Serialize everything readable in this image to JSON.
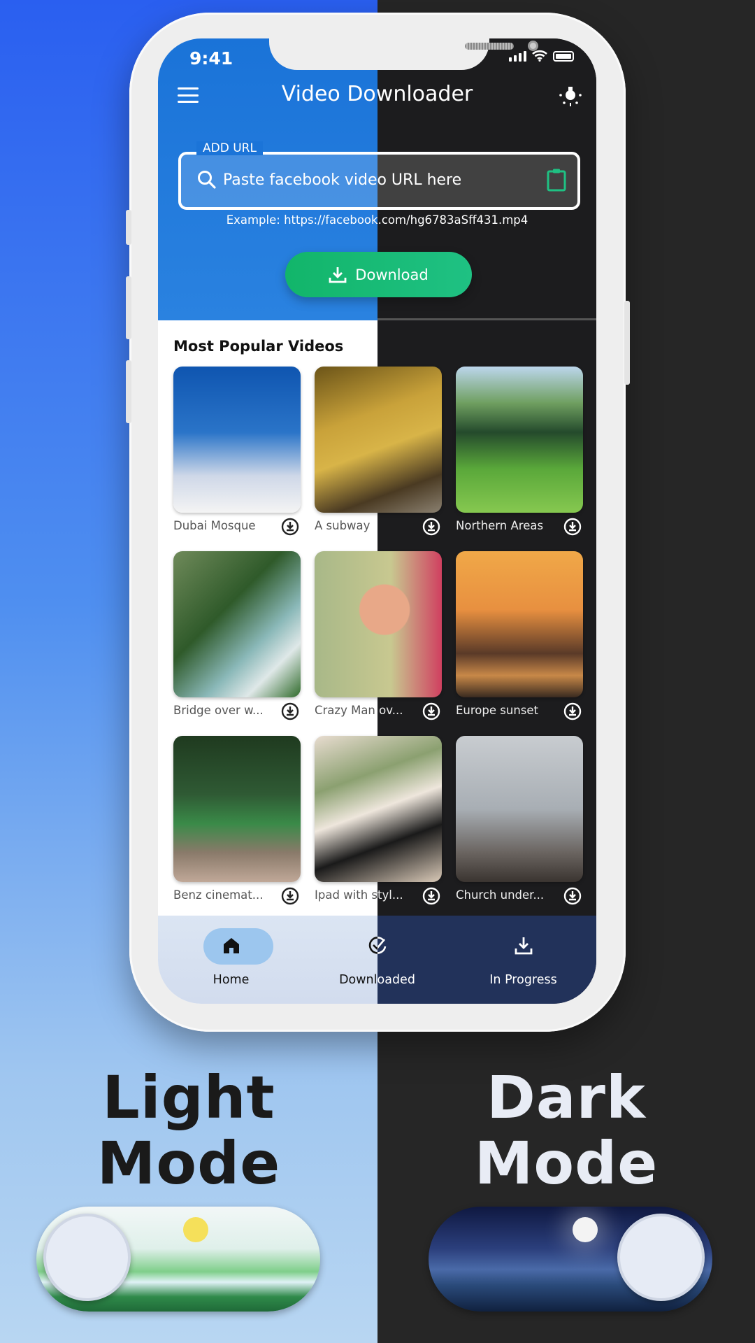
{
  "status_bar": {
    "time": "9:41"
  },
  "header": {
    "title": "Video Downloader",
    "menu_icon": "hamburger-icon",
    "theme_icon": "lightbulb-icon"
  },
  "url_input": {
    "label": "ADD URL",
    "placeholder": "Paste facebook video URL here",
    "value": "",
    "example": "Example: https://facebook.com/hg6783aSff431.mp4"
  },
  "download_button": {
    "label": "Download"
  },
  "popular": {
    "title": "Most Popular Videos",
    "videos": [
      {
        "title": "Dubai Mosque"
      },
      {
        "title": "A subway"
      },
      {
        "title": "Northern Areas"
      },
      {
        "title": "Bridge over w..."
      },
      {
        "title": "Crazy Man ov..."
      },
      {
        "title": "Europe sunset"
      },
      {
        "title": "Benz cinemat..."
      },
      {
        "title": "Ipad with styl..."
      },
      {
        "title": "Church under..."
      }
    ]
  },
  "bottom_nav": {
    "items": [
      {
        "label": "Home",
        "active": true
      },
      {
        "label": "Downloaded"
      },
      {
        "label": "In Progress"
      }
    ]
  },
  "promo": {
    "light": [
      "Light",
      "Mode"
    ],
    "dark": [
      "Dark",
      "Mode"
    ]
  },
  "colors": {
    "accent_green": "#14b86f",
    "light_header": "#1a73d8",
    "dark_bg": "#1c1c1e",
    "dark_nav": "#22325a"
  }
}
